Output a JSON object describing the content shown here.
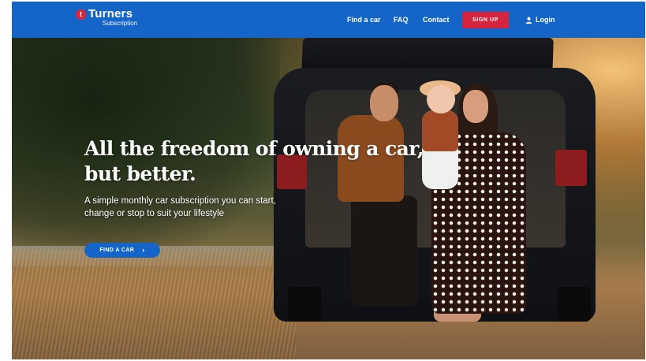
{
  "brand": {
    "name": "Turners",
    "subtitle": "Subscription",
    "logo_glyph": "t",
    "logo_color": "#e0213a"
  },
  "nav": {
    "links": [
      {
        "label": "Find a car"
      },
      {
        "label": "FAQ"
      },
      {
        "label": "Contact"
      }
    ],
    "signup_label": "SIGN UP",
    "login_label": "Login",
    "login_icon": "user-icon",
    "bar_color": "#1565c8",
    "signup_color": "#d7243e"
  },
  "hero": {
    "title": "All the freedom of owning a car, but better.",
    "subtitle": "A simple monthly car subscription you can start, change or stop to suit your lifestyle",
    "cta_label": "FIND A CAR",
    "cta_icon": "chevron-right-icon",
    "image_subject": "family-sitting-in-open-car-boot"
  }
}
